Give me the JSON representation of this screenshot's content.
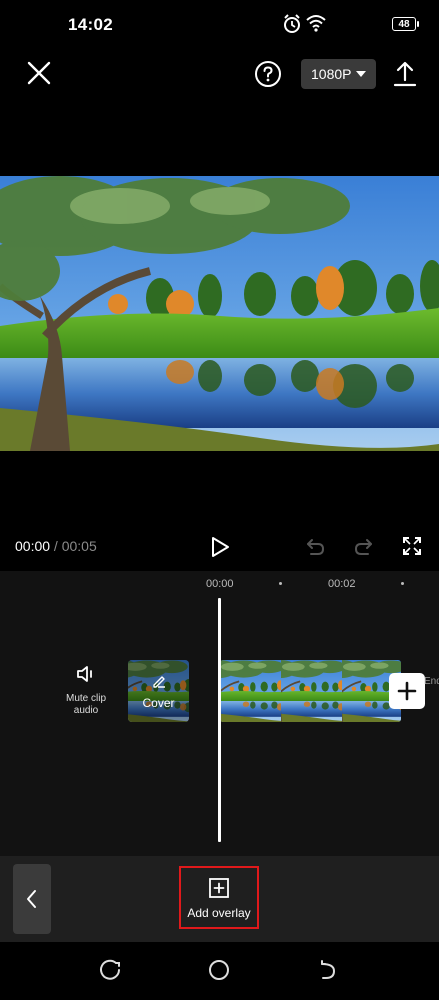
{
  "status_bar": {
    "time": "14:02",
    "battery": "48",
    "icons": [
      "alarm-icon",
      "wifi-icon",
      "battery-icon"
    ]
  },
  "toolbar": {
    "resolution": "1080P",
    "icons": [
      "close-icon",
      "help-icon",
      "chevron-down-icon",
      "export-icon"
    ]
  },
  "player": {
    "current_time": "00:00",
    "separator": " / ",
    "total_time": "00:05",
    "icons": [
      "play-icon",
      "undo-icon",
      "redo-icon",
      "fullscreen-icon"
    ]
  },
  "timeline": {
    "ruler": [
      "00:00",
      "00:02"
    ],
    "mute_label": "Mute clip audio",
    "cover_label": "Cover",
    "end_label": "End",
    "icons": [
      "speaker-icon",
      "pencil-icon",
      "plus-icon"
    ]
  },
  "bottom_bar": {
    "add_overlay_label": "Add overlay",
    "icons": [
      "chevron-left-icon",
      "add-overlay-icon"
    ]
  },
  "nav": {
    "icons": [
      "recents-icon",
      "home-icon",
      "back-icon"
    ]
  },
  "colors": {
    "background": "#000000",
    "timeline_bg": "#121212",
    "bottom_bar_bg": "#1f1f1f",
    "highlight_border": "#e0191b",
    "resolution_bg": "#3a3a3a"
  }
}
